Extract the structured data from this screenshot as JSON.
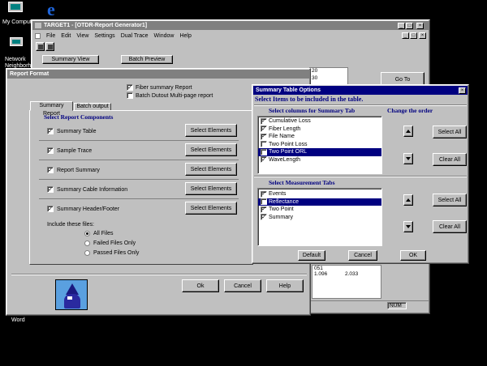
{
  "desktop": {
    "icons": [
      {
        "label": "My Comput",
        "name": "my-computer"
      },
      {
        "label": "Network Neighborhoo",
        "name": "network-neighborhood"
      },
      {
        "label": "Word",
        "name": "word"
      }
    ]
  },
  "main_window": {
    "title": "TARGET1 - [OTDR-Report Generator1]",
    "menu": [
      "File",
      "Edit",
      "View",
      "Settings",
      "Dual Trace",
      "Window",
      "Help"
    ],
    "toolbar": {
      "summary_view": "Summary View",
      "batch_preview": "Batch Preview"
    },
    "goto_label": "Go To",
    "bg_values": [
      "20",
      "30",
      "051",
      "1.096",
      "2.033"
    ],
    "status_num": "NUM"
  },
  "report_format": {
    "title": "Report Format",
    "fiber_summary": {
      "label": "Fiber summary Report",
      "checked": true
    },
    "batch_output_multi": {
      "label": "Batch Dutout Multi-page report",
      "checked": false
    },
    "tabs": [
      "Summary Report",
      "Batch output"
    ],
    "section_title": "Select Report Components",
    "components": [
      {
        "label": "Summary Table",
        "checked": true,
        "button": "Select Elements"
      },
      {
        "label": "Sample Trace",
        "checked": true,
        "button": "Select Elements"
      },
      {
        "label": "Report Summary",
        "checked": true,
        "button": "Select Elements"
      },
      {
        "label": "Summary Cable Information",
        "checked": true,
        "button": "Select Elements"
      },
      {
        "label": "Summary Header/Footer",
        "checked": true,
        "button": "Select Elements"
      }
    ],
    "include_label": "Include these files:",
    "include_options": [
      {
        "label": "All Files",
        "selected": true
      },
      {
        "label": "Failed Files Only",
        "selected": false
      },
      {
        "label": "Passed Files Only",
        "selected": false
      }
    ],
    "buttons": {
      "ok": "Ok",
      "cancel": "Cancel",
      "help": "Help"
    }
  },
  "summary_options": {
    "title": "Summary Table Options",
    "close": "×",
    "subtitle": "Select Items to be included in the table.",
    "columns_header": "Select columns for Summary Tab",
    "order_header": "Change the order",
    "columns": [
      {
        "label": "Cumulative Loss",
        "checked": true,
        "selected": false
      },
      {
        "label": "Fiber Length",
        "checked": true,
        "selected": false
      },
      {
        "label": "File Name",
        "checked": true,
        "selected": false
      },
      {
        "label": "Two Point Loss",
        "checked": false,
        "selected": false
      },
      {
        "label": "Two Point ORL",
        "checked": false,
        "selected": true
      },
      {
        "label": "WaveLength",
        "checked": true,
        "selected": false
      }
    ],
    "tabs_header": "Select Measurement Tabs",
    "measurement_tabs": [
      {
        "label": "Events",
        "checked": true,
        "selected": false
      },
      {
        "label": "Reflectance",
        "checked": false,
        "selected": true
      },
      {
        "label": "Two Point",
        "checked": true,
        "selected": false
      },
      {
        "label": "Summary",
        "checked": true,
        "selected": false
      }
    ],
    "select_all": "Select All",
    "clear_all": "Clear All",
    "buttons": {
      "default": "Default",
      "cancel": "Cancel",
      "ok": "OK"
    }
  },
  "colors": {
    "title_active": "#000080",
    "title_inactive": "#808080",
    "dialog_bg": "#c0c0c0",
    "accent_text": "#000080"
  }
}
